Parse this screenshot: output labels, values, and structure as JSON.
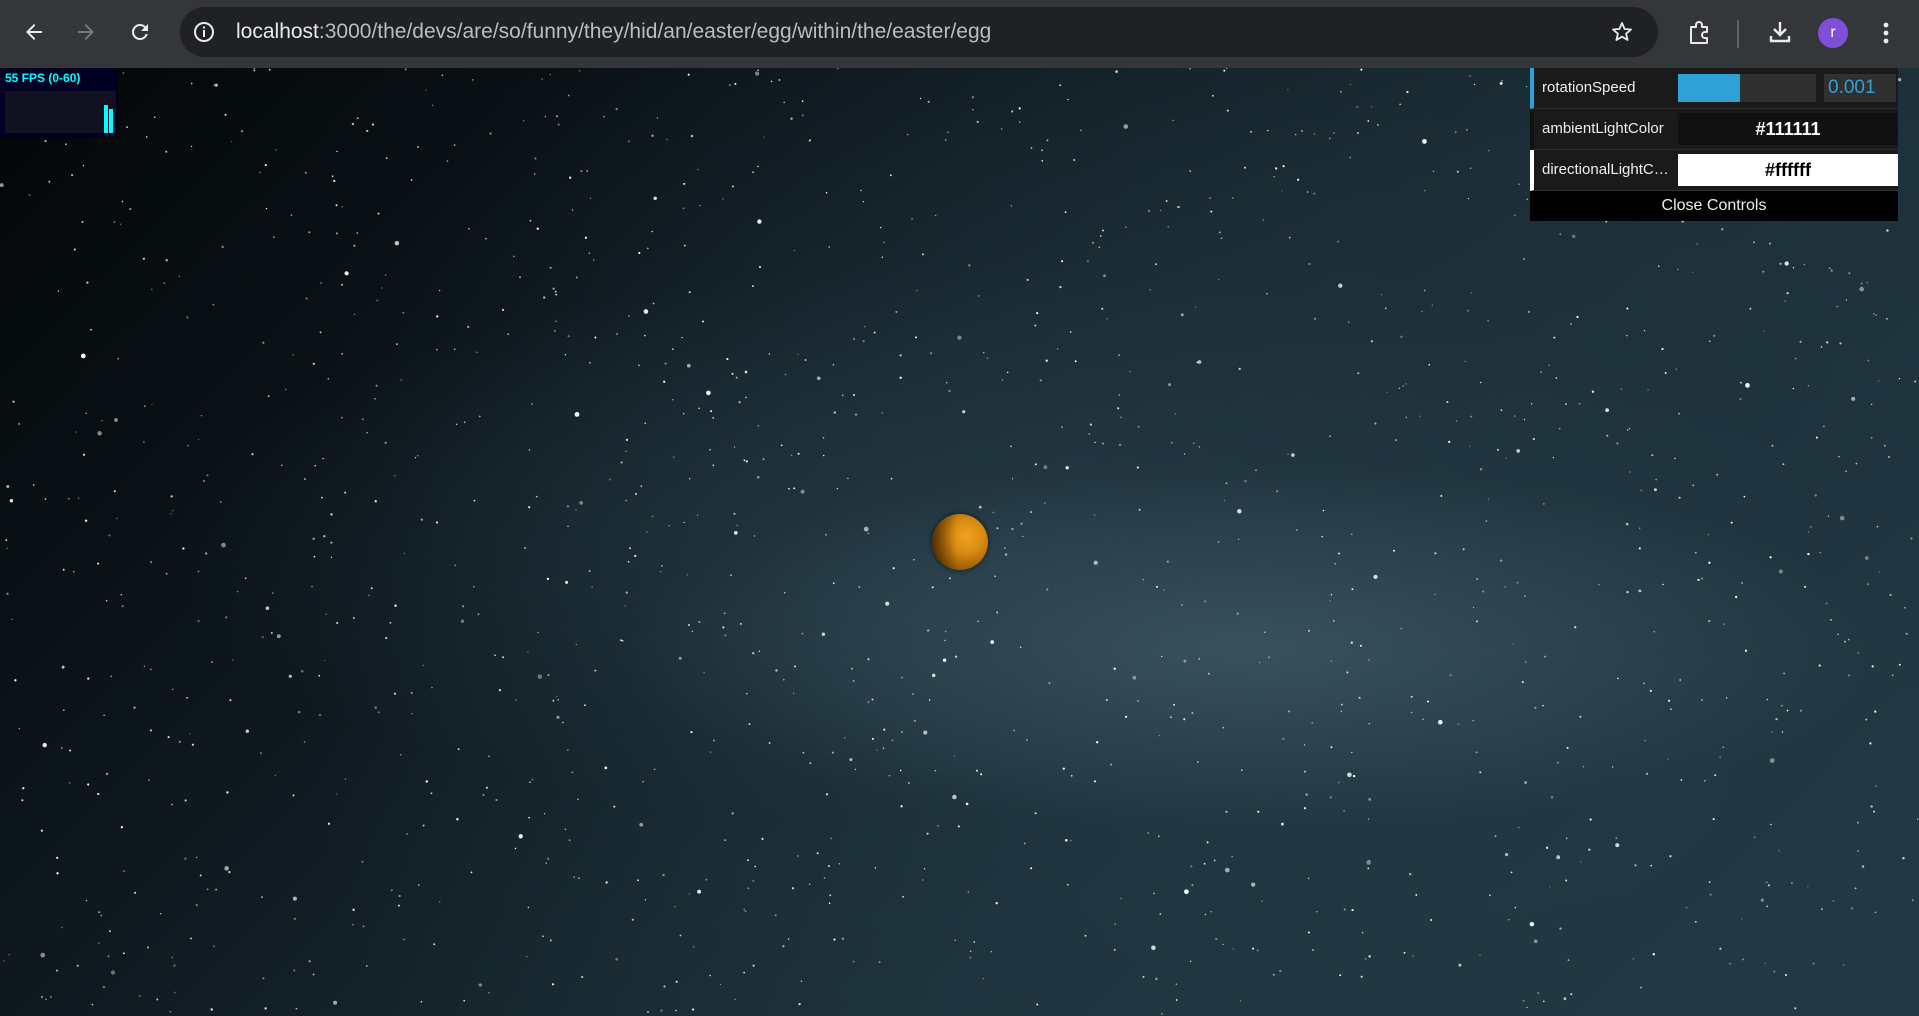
{
  "browser": {
    "url_host": "localhost",
    "url_path": ":3000/the/devs/are/so/funny/they/hid/an/easter/egg/within/the/easter/egg",
    "avatar_letter": "r",
    "icons": [
      "back-arrow-icon",
      "forward-arrow-icon",
      "reload-icon",
      "info-icon",
      "star-icon",
      "extensions-icon",
      "download-icon",
      "kebab-menu-icon"
    ]
  },
  "stats": {
    "fps_label": "55 FPS (0-60)"
  },
  "gui": {
    "rotation_label": "rotationSpeed",
    "rotation_value": "0.001",
    "rotation_fill_fraction": 0.45,
    "ambient_label": "ambientLightColor",
    "ambient_value": "#111111",
    "directional_label": "directionalLightColor",
    "directional_value": "#ffffff",
    "close_label": "Close Controls",
    "accent_color": "#2fa1d6"
  },
  "scene": {
    "planet_color": "#d98a10"
  }
}
